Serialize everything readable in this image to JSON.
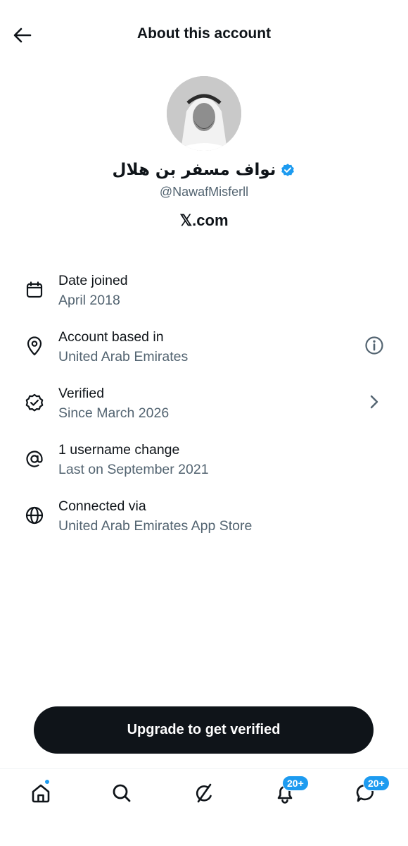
{
  "header": {
    "title": "About this account"
  },
  "profile": {
    "display_name": "نواف مسفر بن هلال",
    "handle": "@NawafMisferll",
    "platform": "𝕏.com",
    "verified_badge_color": "#1d9bf0"
  },
  "info": {
    "date_joined": {
      "title": "Date joined",
      "value": "April 2018",
      "icon": "calendar-icon"
    },
    "based_in": {
      "title": "Account based in",
      "value": "United Arab Emirates",
      "icon": "location-pin-icon",
      "trailing": "info-icon"
    },
    "verified": {
      "title": "Verified",
      "value": "Since March 2026",
      "icon": "verified-outline-icon",
      "trailing": "chevron-right-icon"
    },
    "username": {
      "title": "1 username change",
      "value": "Last on September 2021",
      "icon": "at-sign-icon"
    },
    "connected": {
      "title": "Connected via",
      "value": "United Arab Emirates App Store",
      "icon": "globe-icon"
    }
  },
  "cta": {
    "label": "Upgrade to get verified"
  },
  "tabbar": {
    "notifications_count": "20+",
    "messages_count": "20+",
    "accent": "#1d9bf0"
  }
}
